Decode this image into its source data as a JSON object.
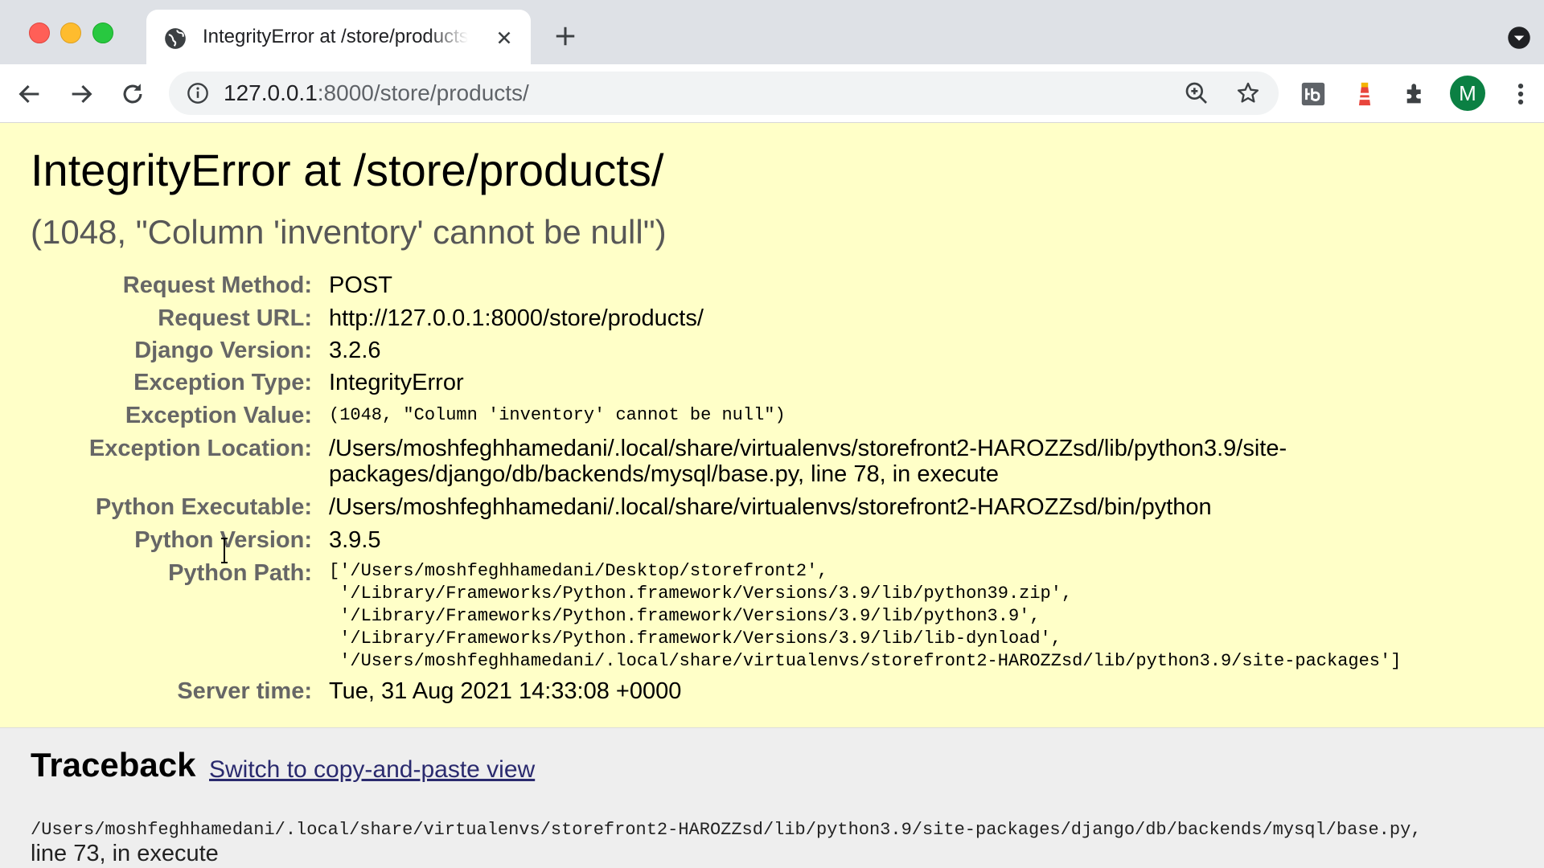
{
  "browser": {
    "tab_title": "IntegrityError at /store/products/",
    "url_host": "127.0.0.1",
    "url_rest": ":8000/store/products/",
    "avatar_letter": "M",
    "colors": {
      "tabbar": "#dee1e6",
      "avatar": "#0b8043"
    }
  },
  "page": {
    "title": "IntegrityError at /store/products/",
    "subtitle": "(1048, \"Column 'inventory' cannot be null\")",
    "meta": [
      {
        "label": "Request Method:",
        "value": "POST"
      },
      {
        "label": "Request URL:",
        "value": "http://127.0.0.1:8000/store/products/"
      },
      {
        "label": "Django Version:",
        "value": "3.2.6"
      },
      {
        "label": "Exception Type:",
        "value": "IntegrityError"
      },
      {
        "label": "Exception Value:",
        "value": "(1048, \"Column 'inventory' cannot be null\")"
      },
      {
        "label": "Exception Location:",
        "value_line1": "/Users/moshfeghhamedani/.local/share/virtualenvs/storefront2-HAROZZsd/lib/python3.9/site-",
        "value_line2": "packages/django/db/backends/mysql/base.py, line 78, in execute"
      },
      {
        "label": "Python Executable:",
        "value": "/Users/moshfeghhamedani/.local/share/virtualenvs/storefront2-HAROZZsd/bin/python"
      },
      {
        "label": "Python Version:",
        "value": "3.9.5"
      },
      {
        "label": "Python Path:",
        "lines": [
          "['/Users/moshfeghhamedani/Desktop/storefront2',",
          " '/Library/Frameworks/Python.framework/Versions/3.9/lib/python39.zip',",
          " '/Library/Frameworks/Python.framework/Versions/3.9/lib/python3.9',",
          " '/Library/Frameworks/Python.framework/Versions/3.9/lib/lib-dynload',",
          " '/Users/moshfeghhamedani/.local/share/virtualenvs/storefront2-HAROZZsd/lib/python3.9/site-packages']"
        ]
      },
      {
        "label": "Server time:",
        "value": "Tue, 31 Aug 2021 14:33:08 +0000"
      }
    ],
    "colors": {
      "summary_bg": "#ffffc8",
      "label": "#666666",
      "link": "#2a2a6e"
    }
  },
  "traceback": {
    "title": "Traceback",
    "switch_link": "Switch to copy-and-paste view",
    "frame_path": "/Users/moshfeghhamedani/.local/share/virtualenvs/storefront2-HAROZZsd/lib/python3.9/site-packages/django/db/backends/mysql/base.py,",
    "frame_line": "line 73, in execute"
  }
}
